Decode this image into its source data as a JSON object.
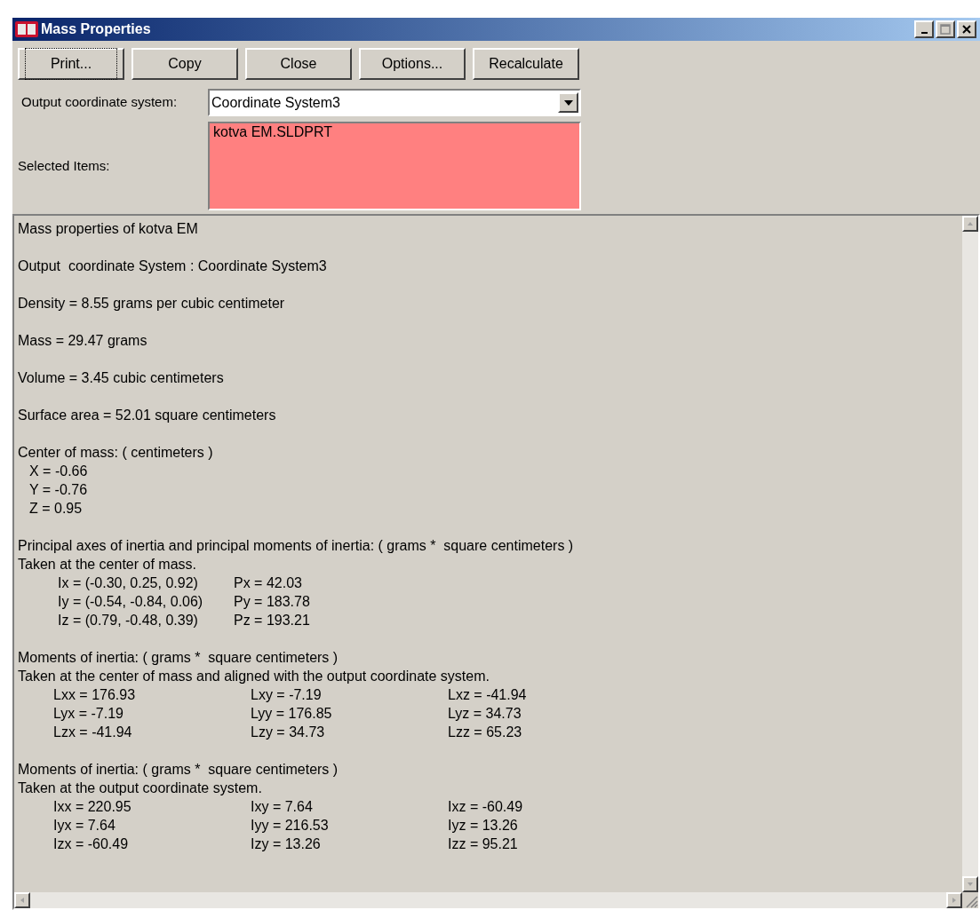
{
  "window": {
    "title": "Mass Properties"
  },
  "buttons": [
    {
      "label": "Print...",
      "focused": true
    },
    {
      "label": "Copy",
      "focused": false
    },
    {
      "label": "Close",
      "focused": false
    },
    {
      "label": "Options...",
      "focused": false
    },
    {
      "label": "Recalculate",
      "focused": false
    }
  ],
  "coordinate_system": {
    "label": "Output coordinate system:",
    "value": "Coordinate System3"
  },
  "selected_items": {
    "label": "Selected Items:",
    "items": [
      "kotva EM.SLDPRT"
    ]
  },
  "report": [
    {
      "lines": [
        {
          "kind": "text",
          "cells": [
            "Mass properties of kotva EM"
          ]
        }
      ]
    },
    {
      "lines": [
        {
          "kind": "text",
          "cells": [
            "Output  coordinate System : Coordinate System3"
          ]
        }
      ]
    },
    {
      "lines": [
        {
          "kind": "text",
          "cells": [
            "Density = 8.55 grams per cubic centimeter"
          ]
        }
      ]
    },
    {
      "lines": [
        {
          "kind": "text",
          "cells": [
            "Mass = 29.47 grams"
          ]
        }
      ]
    },
    {
      "lines": [
        {
          "kind": "text",
          "cells": [
            "Volume = 3.45 cubic centimeters"
          ]
        }
      ]
    },
    {
      "lines": [
        {
          "kind": "text",
          "cells": [
            "Surface area = 52.01 square centimeters"
          ]
        }
      ]
    },
    {
      "lines": [
        {
          "kind": "text",
          "cells": [
            "Center of mass: ( centimeters )"
          ]
        },
        {
          "kind": "value",
          "cells": [
            "X = -0.66"
          ]
        },
        {
          "kind": "value",
          "cells": [
            "Y = -0.76"
          ]
        },
        {
          "kind": "value",
          "cells": [
            "Z = 0.95"
          ]
        }
      ]
    },
    {
      "lines": [
        {
          "kind": "text",
          "cells": [
            "Principal axes of inertia and principal moments of inertia: ( grams *  square centimeters )"
          ]
        },
        {
          "kind": "text",
          "cells": [
            "Taken at the center of mass."
          ]
        },
        {
          "kind": "pair",
          "cells": [
            "Ix = (-0.30, 0.25, 0.92)",
            "Px = 42.03"
          ]
        },
        {
          "kind": "pair",
          "cells": [
            "Iy = (-0.54, -0.84, 0.06)",
            "Py = 183.78"
          ]
        },
        {
          "kind": "pair",
          "cells": [
            "Iz = (0.79, -0.48, 0.39)",
            "Pz = 193.21"
          ]
        }
      ]
    },
    {
      "lines": [
        {
          "kind": "text",
          "cells": [
            "Moments of inertia: ( grams *  square centimeters )"
          ]
        },
        {
          "kind": "text",
          "cells": [
            "Taken at the center of mass and aligned with the output coordinate system."
          ]
        },
        {
          "kind": "triple",
          "cells": [
            "Lxx = 176.93",
            "Lxy = -7.19",
            "Lxz = -41.94"
          ]
        },
        {
          "kind": "triple",
          "cells": [
            "Lyx = -7.19",
            "Lyy = 176.85",
            "Lyz = 34.73"
          ]
        },
        {
          "kind": "triple",
          "cells": [
            "Lzx = -41.94",
            "Lzy = 34.73",
            "Lzz = 65.23"
          ]
        }
      ]
    },
    {
      "lines": [
        {
          "kind": "text",
          "cells": [
            "Moments of inertia: ( grams *  square centimeters )"
          ]
        },
        {
          "kind": "text",
          "cells": [
            "Taken at the output coordinate system."
          ]
        },
        {
          "kind": "triple",
          "cells": [
            "Ixx = 220.95",
            "Ixy = 7.64",
            "Ixz = -60.49"
          ]
        },
        {
          "kind": "triple",
          "cells": [
            "Iyx = 7.64",
            "Iyy = 216.53",
            "Iyz = 13.26"
          ]
        },
        {
          "kind": "triple",
          "cells": [
            "Izx = -60.49",
            "Izy = 13.26",
            "Izz = 95.21"
          ]
        }
      ]
    }
  ]
}
